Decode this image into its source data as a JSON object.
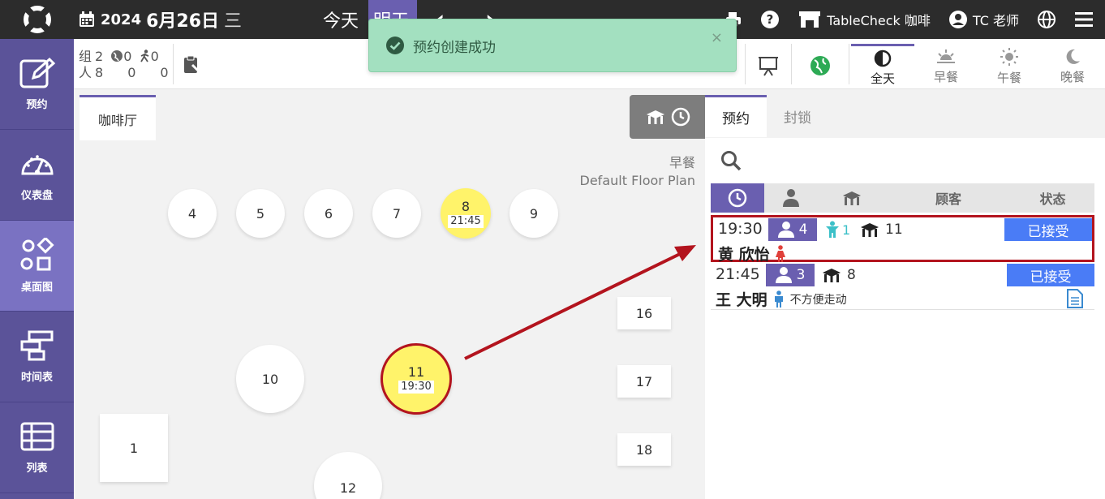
{
  "topbar": {
    "year": "2024",
    "date": "6月26日",
    "weekday": "三",
    "today_label": "今天",
    "tomorrow_label": "明天",
    "restaurant": "TableCheck 咖啡",
    "user": "TC 老师"
  },
  "sidebar": {
    "items": [
      {
        "label": "预约"
      },
      {
        "label": "仪表盘"
      },
      {
        "label": "桌面图"
      },
      {
        "label": "时间表"
      },
      {
        "label": "列表"
      }
    ]
  },
  "toolbar": {
    "groups_label": "组",
    "groups_value": "2",
    "people_label": "人",
    "people_value": "8",
    "online_groups": "0",
    "walkin_groups": "0",
    "online_people": "0",
    "walkin_people": "0",
    "meals": [
      {
        "label": "全天"
      },
      {
        "label": "早餐"
      },
      {
        "label": "午餐"
      },
      {
        "label": "晚餐"
      }
    ]
  },
  "toast": {
    "message": "预约创建成功",
    "close": "×"
  },
  "floor": {
    "room_tab": "咖啡厅",
    "meal": "早餐",
    "plan_name": "Default Floor Plan",
    "tables": [
      {
        "no": "4"
      },
      {
        "no": "5"
      },
      {
        "no": "6"
      },
      {
        "no": "7"
      },
      {
        "no": "8",
        "time": "21:45"
      },
      {
        "no": "9"
      },
      {
        "no": "16"
      },
      {
        "no": "10"
      },
      {
        "no": "11",
        "time": "19:30"
      },
      {
        "no": "17"
      },
      {
        "no": "1"
      },
      {
        "no": "18"
      },
      {
        "no": "12"
      }
    ]
  },
  "panel": {
    "tabs": [
      {
        "label": "预约"
      },
      {
        "label": "封锁"
      }
    ],
    "columns": {
      "customer": "顾客",
      "status": "状态"
    },
    "reservations": [
      {
        "time": "19:30",
        "party": "4",
        "kids": "1",
        "table": "11",
        "status": "已接受",
        "name": "黄 欣怡"
      },
      {
        "time": "21:45",
        "party": "3",
        "table": "8",
        "status": "已接受",
        "name": "王 大明",
        "note": "不方便走动"
      }
    ]
  },
  "colors": {
    "accent": "#6a5fb0",
    "status_accepted": "#4a7cf6",
    "highlight": "#b3141e",
    "table_reserved": "#fff36a",
    "toast": "#a3e0c0"
  }
}
